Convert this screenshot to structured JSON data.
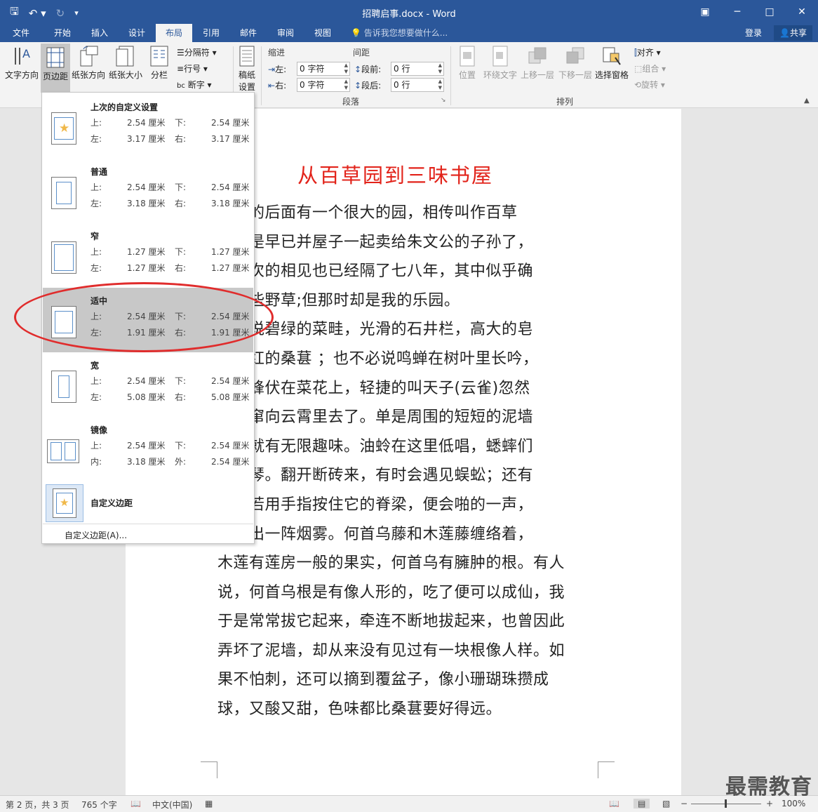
{
  "window": {
    "title": "招聘启事.docx - Word"
  },
  "tabs": [
    {
      "label": "文件"
    },
    {
      "label": "开始"
    },
    {
      "label": "插入"
    },
    {
      "label": "设计"
    },
    {
      "label": "布局"
    },
    {
      "label": "引用"
    },
    {
      "label": "邮件"
    },
    {
      "label": "审阅"
    },
    {
      "label": "视图"
    }
  ],
  "active_tab": "布局",
  "tell_me": "告诉我您想要做什么...",
  "account": {
    "login": "登录",
    "share": "共享"
  },
  "ribbon": {
    "page_setup": {
      "text_direction": "文字方向",
      "margins": "页边距",
      "orientation": "纸张方向",
      "size": "纸张大小",
      "columns": "分栏",
      "breaks": "分隔符",
      "line_numbers": "行号",
      "hyphenation": "断字"
    },
    "draft": "稿纸\n设置",
    "draft_line1": "稿纸",
    "draft_line2": "设置",
    "paragraph": {
      "indent_label": "缩进",
      "spacing_label": "间距",
      "left_label": "左:",
      "right_label": "右:",
      "before_label": "段前:",
      "after_label": "段后:",
      "left_value": "0 字符",
      "right_value": "0 字符",
      "before_value": "0 行",
      "after_value": "0 行",
      "group_label": "段落"
    },
    "arrange": {
      "position": "位置",
      "wrap": "环绕文字",
      "forward": "上移一层",
      "backward": "下移一层",
      "selection_pane": "选择窗格",
      "align": "对齐",
      "group": "组合",
      "rotate": "旋转",
      "group_label": "排列"
    }
  },
  "margin_presets": [
    {
      "name": "上次的自定义设置",
      "k1": "上:",
      "v1": "2.54 厘米",
      "k2": "下:",
      "v2": "2.54 厘米",
      "k3": "左:",
      "v3": "3.17 厘米",
      "k4": "右:",
      "v4": "3.17 厘米"
    },
    {
      "name": "普通",
      "k1": "上:",
      "v1": "2.54 厘米",
      "k2": "下:",
      "v2": "2.54 厘米",
      "k3": "左:",
      "v3": "3.18 厘米",
      "k4": "右:",
      "v4": "3.18 厘米"
    },
    {
      "name": "窄",
      "k1": "上:",
      "v1": "1.27 厘米",
      "k2": "下:",
      "v2": "1.27 厘米",
      "k3": "左:",
      "v3": "1.27 厘米",
      "k4": "右:",
      "v4": "1.27 厘米"
    },
    {
      "name": "适中",
      "k1": "上:",
      "v1": "2.54 厘米",
      "k2": "下:",
      "v2": "2.54 厘米",
      "k3": "左:",
      "v3": "1.91 厘米",
      "k4": "右:",
      "v4": "1.91 厘米"
    },
    {
      "name": "宽",
      "k1": "上:",
      "v1": "2.54 厘米",
      "k2": "下:",
      "v2": "2.54 厘米",
      "k3": "左:",
      "v3": "5.08 厘米",
      "k4": "右:",
      "v4": "5.08 厘米"
    },
    {
      "name": "镜像",
      "k1": "上:",
      "v1": "2.54 厘米",
      "k2": "下:",
      "v2": "2.54 厘米",
      "k3": "内:",
      "v3": "3.18 厘米",
      "k4": "外:",
      "v4": "2.54 厘米"
    }
  ],
  "custom_margins_option": "自定义边距",
  "custom_margins_link": "自定义边距(A)...",
  "document": {
    "title": "从百草园到三味书屋",
    "lines": [
      "我家的后面有一个很大的园，相传叫作百草",
      "现在是早已并屋子一起卖给朱文公的子孙了，",
      "最末次的相见也已经隔了七八年，其中似乎确",
      "有一些野草;但那时却是我的乐园。",
      "不必说碧绿的菜畦，光滑的石井栏，高大的皂",
      "，紫红的桑葚 ；也不必说鸣蝉在树叶里长吟，",
      "的黄蜂伏在菜花上，轻捷的叫天子(云雀)忽然",
      "间直窜向云霄里去了。单是周围的短短的泥墙",
      "带，就有无限趣味。油蛉在这里低唱，蟋蟀们",
      "里弹琴。翻开断砖来，有时会遇见蜈蚣；还有",
      "，倘若用手指按住它的脊梁，便会啪的一声，",
      "窍喷出一阵烟雾。何首乌藤和木莲藤缠络着，",
      "木莲有莲房一般的果实，何首乌有臃肿的根。有人",
      "说，何首乌根是有像人形的，吃了便可以成仙，我",
      "于是常常拔它起来，牵连不断地拔起来，也曾因此",
      "弄坏了泥墙，却从来没有见过有一块根像人样。如",
      "果不怕刺，还可以摘到覆盆子，像小珊瑚珠攒成",
      "球，又酸又甜，色味都比桑葚要好得远。"
    ]
  },
  "status": {
    "page": "第 2 页，共 3 页",
    "words": "765 个字",
    "language": "中文(中国)",
    "zoom": "100%"
  },
  "watermark": "最需教育"
}
